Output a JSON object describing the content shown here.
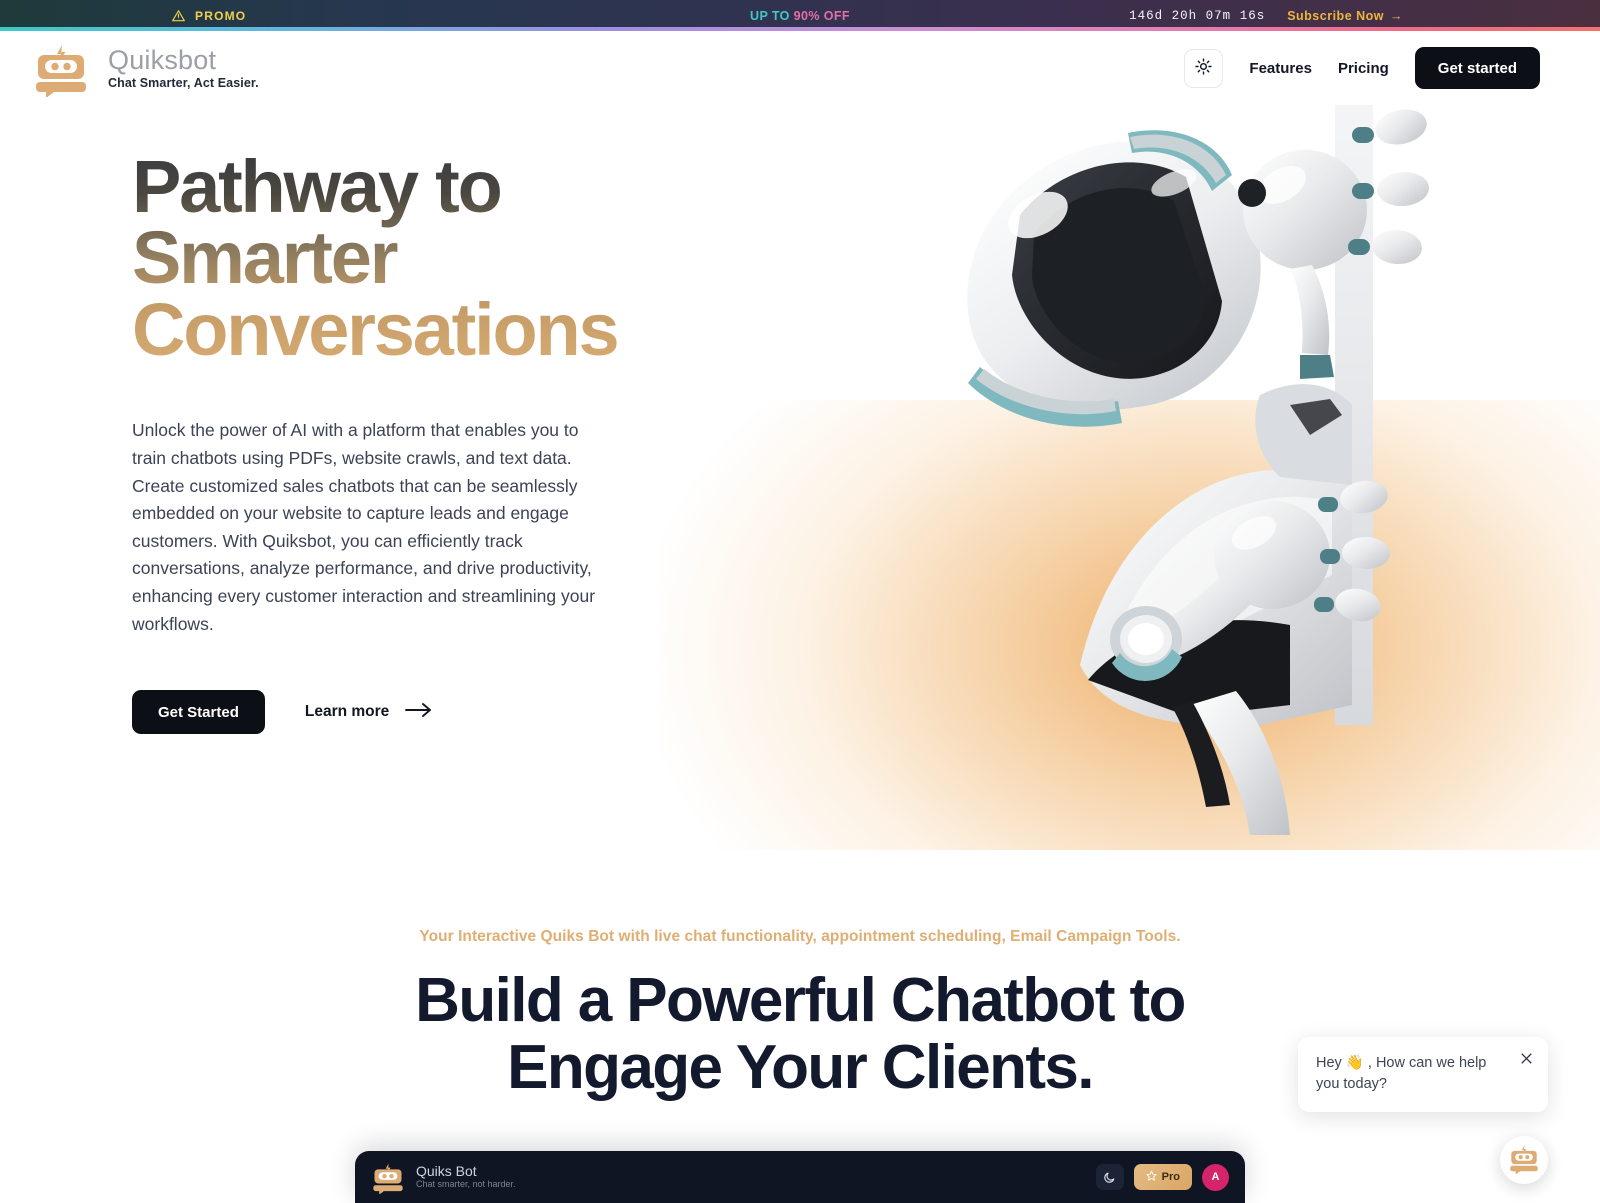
{
  "promo": {
    "warn_icon": "warning-triangle-icon",
    "label": "PROMO",
    "center_part1": "UP TO ",
    "center_part2": "90% OFF",
    "countdown": "146d 20h 07m 16s",
    "subscribe_label": "Subscribe Now",
    "subscribe_arrow": "→",
    "colors": {
      "label": "#f2cf4e",
      "teal": "#3fc9c4",
      "pink": "#e36fa9",
      "gold": "#edb53f"
    }
  },
  "header": {
    "logo_icon": "quiksbot-robot-logo",
    "brand_name": "Quiksbot",
    "brand_tagline": "Chat Smarter, Act Easier.",
    "theme_icon": "sun-icon",
    "nav": [
      {
        "label": "Features"
      },
      {
        "label": "Pricing"
      }
    ],
    "cta_label": "Get started"
  },
  "hero": {
    "title_line1": "Pathway to",
    "title_line2": "Smarter",
    "title_line3": "Conversations",
    "description": "Unlock the power of AI with a platform that enables you to train chatbots using PDFs, website crawls, and text data. Create customized sales chatbots that can be seamlessly embedded on your website to capture leads and engage customers. With Quiksbot, you can efficiently track conversations, analyze performance, and drive productivity, enhancing every customer interaction and streamlining your workflows.",
    "primary_cta": "Get Started",
    "secondary_cta": "Learn more",
    "secondary_arrow": "→",
    "image_alt": "3d-robot-illustration",
    "gradient_from": "#3a3b40",
    "gradient_to": "#d7ab72"
  },
  "feature_section": {
    "eyebrow": "Your Interactive Quiks Bot with live chat functionality, appointment scheduling, Email Campaign Tools.",
    "heading_line1": "Build a Powerful Chatbot to",
    "heading_line2": "Engage Your Clients.",
    "eyebrow_color": "#dfae73",
    "heading_color": "#131a2e"
  },
  "chat_preview": {
    "logo_icon": "quiksbot-robot-logo",
    "name": "Quiks Bot",
    "tagline": "Chat smarter, not harder.",
    "theme_icon": "moon-icon",
    "pro_icon": "star-icon",
    "pro_label": "Pro",
    "avatar_initial": "A"
  },
  "chat_widget": {
    "message": "Hey 👋 , How can we help you today?",
    "close_icon": "close-icon",
    "fab_icon": "quiksbot-robot-logo"
  }
}
